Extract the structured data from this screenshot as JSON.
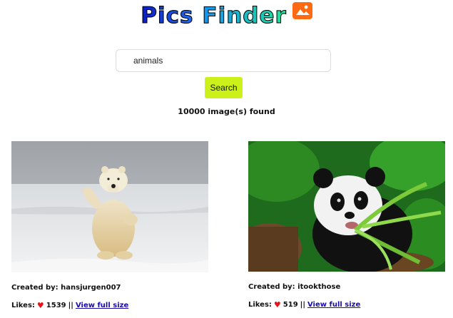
{
  "header": {
    "title_word_1": "Pics",
    "title_word_2": "Finder",
    "logo_icon": "image-icon",
    "logo_color": "#ff6a13"
  },
  "search": {
    "value": "animals",
    "button_label": "Search",
    "button_color": "#ccf01a"
  },
  "results": {
    "count_text": "10000 image(s) found",
    "cards": [
      {
        "image_icon": "polar-bear-photo",
        "created_label": "Created by: hansjurgen007",
        "likes_label": "Likes:",
        "likes_count": "1539",
        "separator": "||",
        "link_label": "View full size"
      },
      {
        "image_icon": "panda-photo",
        "created_label": "Created by: itookthose",
        "likes_label": "Likes:",
        "likes_count": "519",
        "separator": "||",
        "link_label": "View full size"
      }
    ]
  }
}
